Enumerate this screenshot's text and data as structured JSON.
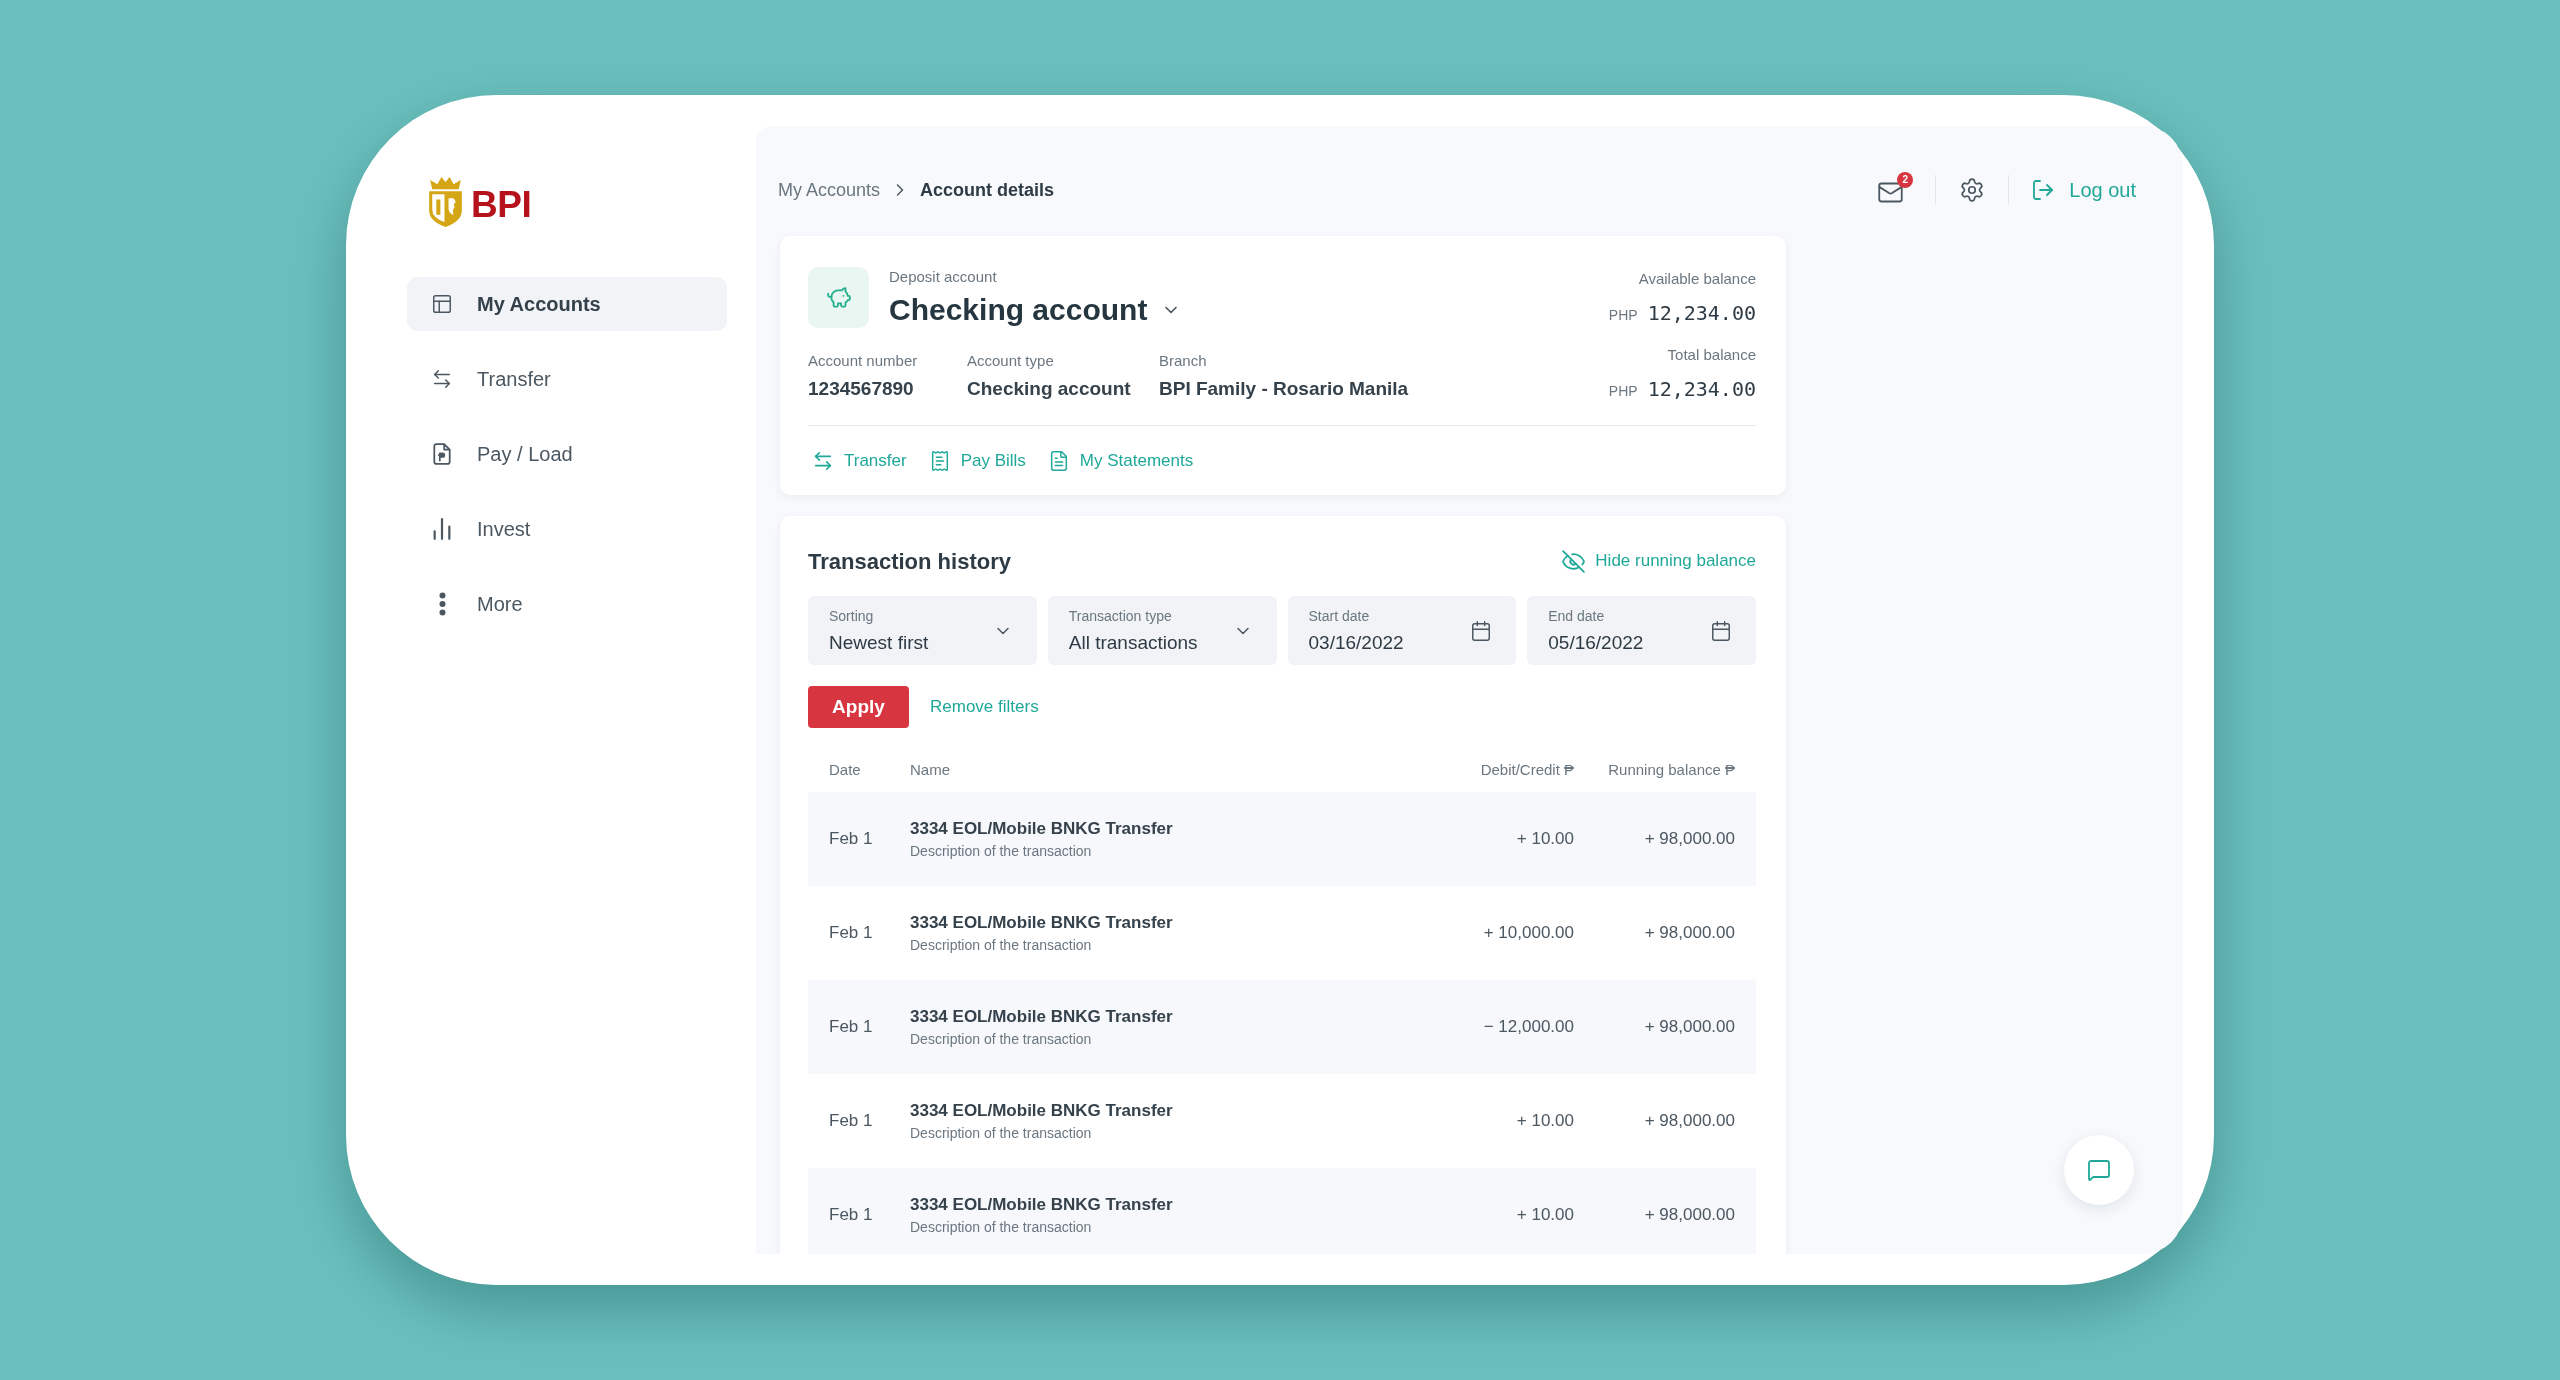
{
  "sidebar": {
    "logo": "BPI",
    "items": [
      {
        "label": "My Accounts",
        "selected": true
      },
      {
        "label": "Transfer",
        "selected": false
      },
      {
        "label": "Pay / Load",
        "selected": false
      },
      {
        "label": "Invest",
        "selected": false
      },
      {
        "label": "More",
        "selected": false
      }
    ]
  },
  "breadcrumb": [
    {
      "label": "My Accounts",
      "current": false
    },
    {
      "label": "Account details",
      "current": true
    }
  ],
  "toolbar": {
    "unread_count": "2",
    "logout": "Log out"
  },
  "account": {
    "category": "Deposit account",
    "name": "Checking account",
    "available_balance": {
      "label": "Available balance",
      "currency": "PHP",
      "amount": "12,234.00"
    },
    "details": [
      {
        "label": "Account number",
        "value": "1234567890"
      },
      {
        "label": "Account type",
        "value": "Checking account"
      },
      {
        "label": "Branch",
        "value": "BPI Family - Rosario Manila"
      }
    ],
    "total_balance": {
      "label": "Total balance",
      "currency": "PHP",
      "amount": "12,234.00"
    },
    "actions": [
      "Transfer",
      "Pay Bills",
      "My Statements"
    ]
  },
  "transaction_history": {
    "title": "Transaction history",
    "toggle": "Hide running balance",
    "filters": [
      {
        "kind": "select",
        "label": "Sorting",
        "value": "Newest first"
      },
      {
        "kind": "select",
        "label": "Transaction type",
        "value": "All transactions"
      },
      {
        "kind": "date",
        "label": "Start date",
        "value": "03/16/2022"
      },
      {
        "kind": "date",
        "label": "End date",
        "value": "05/16/2022"
      }
    ],
    "apply": "Apply",
    "remove_filters": "Remove filters",
    "columns": [
      "Date",
      "Name",
      "Debit/Credit ₱",
      "Running balance ₱"
    ],
    "rows": [
      {
        "date": "Feb 1",
        "name": "3334 EOL/Mobile BNKG Transfer",
        "description": "Description of the transaction",
        "amount": "+ 10.00",
        "balance": "+ 98,000.00"
      },
      {
        "date": "Feb 1",
        "name": "3334 EOL/Mobile BNKG Transfer",
        "description": "Description of the transaction",
        "amount": "+ 10,000.00",
        "balance": "+ 98,000.00"
      },
      {
        "date": "Feb 1",
        "name": "3334 EOL/Mobile BNKG Transfer",
        "description": "Description of the transaction",
        "amount": "− 12,000.00",
        "balance": "+ 98,000.00"
      },
      {
        "date": "Feb 1",
        "name": "3334 EOL/Mobile BNKG Transfer",
        "description": "Description of the transaction",
        "amount": "+ 10.00",
        "balance": "+ 98,000.00"
      },
      {
        "date": "Feb 1",
        "name": "3334 EOL/Mobile BNKG Transfer",
        "description": "Description of the transaction",
        "amount": "+ 10.00",
        "balance": "+ 98,000.00"
      }
    ]
  }
}
